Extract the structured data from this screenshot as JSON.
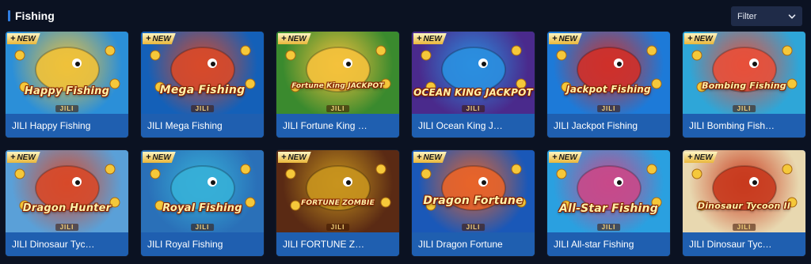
{
  "header": {
    "title": "Fishing",
    "filter_label": "Filter",
    "filter_icon": "chevron-down-icon"
  },
  "badge": {
    "plus": "+",
    "text": "NEW"
  },
  "provider_tag": "JILI",
  "games": [
    {
      "name": "JILI Happy Fishing",
      "caption": "JILI Happy Fishing",
      "logo": "Happy Fishing",
      "bg": [
        "#2b8fd8",
        "#f0c23a"
      ]
    },
    {
      "name": "JILI Mega Fishing",
      "caption": "JILI Mega Fishing",
      "logo": "Mega Fishing",
      "bg": [
        "#1460b8",
        "#d84a2a"
      ]
    },
    {
      "name": "JILI Fortune King Jackpot",
      "caption": "JILI Fortune King …",
      "logo": "Fortune King JACKPOT",
      "bg": [
        "#3a8a2e",
        "#f5c23c"
      ]
    },
    {
      "name": "JILI Ocean King Jackpot",
      "caption": "JILI Ocean King J…",
      "logo": "OCEAN KING JACKPOT",
      "bg": [
        "#4a2a8c",
        "#2b8fe0"
      ]
    },
    {
      "name": "JILI Jackpot Fishing",
      "caption": "JILI Jackpot Fishing",
      "logo": "Jackpot Fishing",
      "bg": [
        "#1d7ad8",
        "#d0302a"
      ]
    },
    {
      "name": "JILI Bombing Fishing",
      "caption": "JILI Bombing Fish…",
      "logo": "Bombing Fishing",
      "bg": [
        "#2ea6d8",
        "#e8503a"
      ]
    },
    {
      "name": "JILI Dinosaur Tycoon",
      "caption": "JILI Dinosaur Tyc…",
      "logo": "Dragon Hunter",
      "bg": [
        "#5aa0d8",
        "#d84a2a"
      ]
    },
    {
      "name": "JILI Royal Fishing",
      "caption": "JILI Royal Fishing",
      "logo": "Royal Fishing",
      "bg": [
        "#2a70b8",
        "#37b0d8"
      ]
    },
    {
      "name": "JILI FORTUNE ZOMBIE",
      "caption": "JILI FORTUNE Z…",
      "logo": "FORTUNE ZOMBIE",
      "bg": [
        "#5a2a14",
        "#c8941e"
      ]
    },
    {
      "name": "JILI Dragon Fortune",
      "caption": "JILI Dragon Fortune",
      "logo": "Dragon Fortune",
      "bg": [
        "#1a58b8",
        "#e8642a"
      ]
    },
    {
      "name": "JILI All-star Fishing",
      "caption": "JILI All-star Fishing",
      "logo": "All-Star Fishing",
      "bg": [
        "#2aa0e0",
        "#c84a8a"
      ]
    },
    {
      "name": "JILI Dinosaur Tycoon II",
      "caption": "JILI Dinosaur Tyc…",
      "logo": "Dinosaur Tycoon II",
      "bg": [
        "#e8d8b0",
        "#c83a1e"
      ]
    }
  ],
  "colors": {
    "page_bg": "#0b1222",
    "caption_bg": "#1f5fb0",
    "accent_bar": "#2f7de1",
    "filter_bg": "#1f2b48"
  }
}
